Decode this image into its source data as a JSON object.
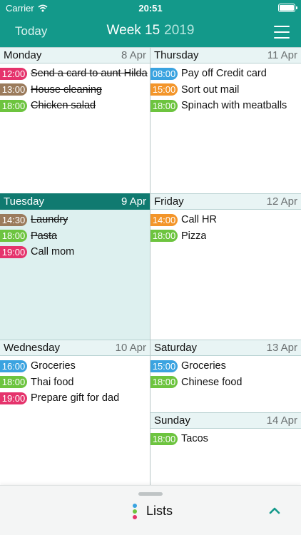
{
  "status_bar": {
    "carrier": "Carrier",
    "time": "20:51"
  },
  "header": {
    "today_label": "Today",
    "week_label": "Week 15",
    "year": "2019"
  },
  "days": [
    {
      "name": "Monday",
      "date": "8 Apr",
      "selected": false,
      "tasks": [
        {
          "time": "12:00",
          "text": "Send a card to aunt Hilda",
          "color": "#e5336c",
          "done": true
        },
        {
          "time": "13:00",
          "text": "House cleaning",
          "color": "#9b7b5c",
          "done": true
        },
        {
          "time": "18:00",
          "text": "Chicken salad",
          "color": "#6dc43f",
          "done": true
        }
      ]
    },
    {
      "name": "Tuesday",
      "date": "9 Apr",
      "selected": true,
      "tasks": [
        {
          "time": "14:30",
          "text": "Laundry",
          "color": "#9b7b5c",
          "done": true
        },
        {
          "time": "18:00",
          "text": "Pasta",
          "color": "#6dc43f",
          "done": true
        },
        {
          "time": "19:00",
          "text": "Call mom",
          "color": "#e5336c",
          "done": false
        }
      ]
    },
    {
      "name": "Wednesday",
      "date": "10 Apr",
      "selected": false,
      "tasks": [
        {
          "time": "16:00",
          "text": "Groceries",
          "color": "#3aa3e0",
          "done": false
        },
        {
          "time": "18:00",
          "text": "Thai food",
          "color": "#6dc43f",
          "done": false
        },
        {
          "time": "19:00",
          "text": "Prepare gift for dad",
          "color": "#e5336c",
          "done": false
        }
      ]
    },
    {
      "name": "Thursday",
      "date": "11 Apr",
      "selected": false,
      "tasks": [
        {
          "time": "08:00",
          "text": "Pay off Credit card",
          "color": "#3aa3e0",
          "done": false
        },
        {
          "time": "15:00",
          "text": "Sort out mail",
          "color": "#f3952a",
          "done": false
        },
        {
          "time": "18:00",
          "text": "Spinach with meatballs",
          "color": "#6dc43f",
          "done": false
        }
      ]
    },
    {
      "name": "Friday",
      "date": "12 Apr",
      "selected": false,
      "tasks": [
        {
          "time": "14:00",
          "text": "Call HR",
          "color": "#f3952a",
          "done": false
        },
        {
          "time": "18:00",
          "text": "Pizza",
          "color": "#6dc43f",
          "done": false
        }
      ]
    },
    {
      "name": "Saturday",
      "date": "13 Apr",
      "selected": false,
      "tasks": [
        {
          "time": "15:00",
          "text": "Groceries",
          "color": "#3aa3e0",
          "done": false
        },
        {
          "time": "18:00",
          "text": "Chinese food",
          "color": "#6dc43f",
          "done": false
        }
      ]
    },
    {
      "name": "Sunday",
      "date": "14 Apr",
      "selected": false,
      "tasks": [
        {
          "time": "18:00",
          "text": "Tacos",
          "color": "#6dc43f",
          "done": false
        }
      ]
    }
  ],
  "bottom_sheet": {
    "label": "Lists",
    "icon_colors": [
      "#3aa3e0",
      "#6dc43f",
      "#e5336c"
    ]
  },
  "theme": {
    "primary": "#13998a",
    "selected_header": "#107a70",
    "selected_bg": "#ddf0ef"
  }
}
